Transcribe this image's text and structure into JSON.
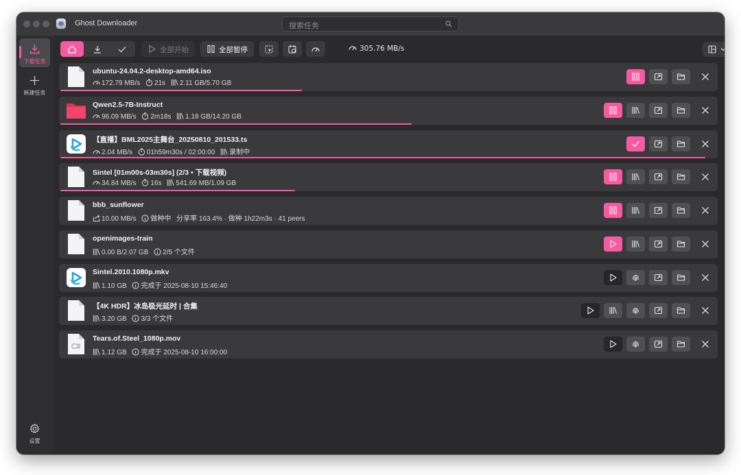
{
  "app": {
    "title": "Ghost Downloader"
  },
  "search": {
    "placeholder": "搜索任务"
  },
  "sidebar": {
    "items": [
      {
        "label": "下载任务",
        "icon": "download-icon",
        "active": true
      },
      {
        "label": "新建任务",
        "icon": "plus-icon",
        "active": false
      }
    ],
    "settings_label": "设置"
  },
  "toolbar": {
    "filters": [
      {
        "icon": "home-icon",
        "active": true
      },
      {
        "icon": "download-icon",
        "active": false
      },
      {
        "icon": "check-icon",
        "active": false
      }
    ],
    "start_all_label": "全部开始",
    "pause_all_label": "全部暂停",
    "total_speed": "305.76 MB/s"
  },
  "colors": {
    "accent": "#f75aa0",
    "background": "#2a2a2c",
    "card": "#3a3a3d"
  },
  "tasks": [
    {
      "name": "ubuntu-24.04.2-desktop-amd64.iso",
      "icon": "file-icon",
      "speed": "172.79 MB/s",
      "eta": "21s",
      "size": "2.11 GB/5.70 GB",
      "progress": 0.368
    },
    {
      "name": "Qwen2.5-7B-Instruct",
      "icon": "folder-icon",
      "speed": "96.09 MB/s",
      "eta": "2m18s",
      "size": "1.18 GB/14.20 GB",
      "progress": 0.536
    },
    {
      "name": "【直播】BML2025主舞台_20250810_201533.ts",
      "icon": "bilibili-icon",
      "speed": "2.04 MB/s",
      "eta": "01h59m30s / 02:00:00",
      "status": "录制中",
      "progress": 0.983
    },
    {
      "name": "Sintel [01m00s-03m30s] (2/3 • 下载视频)",
      "icon": "file-icon",
      "speed": "34.84 MB/s",
      "eta": "16s",
      "size": "541.69 MB/1.09 GB",
      "progress": 0.358
    },
    {
      "name": "bbb_sunflower",
      "icon": "file-icon",
      "speed": "10.00 MB/s",
      "status": "做种中",
      "detail": "分享率 163.4% · 做种 1h22m3s · 41 peers"
    },
    {
      "name": "openimages-train",
      "icon": "file-icon",
      "size": "0.00 B/2.07 GB",
      "detail": "2/5 个文件"
    },
    {
      "name": "Sintel.2010.1080p.mkv",
      "icon": "bilibili-icon",
      "size": "1.10 GB",
      "detail": "完成于 2025-08-10 15:46:40"
    },
    {
      "name": "【4K HDR】冰岛极光延时 | 合集",
      "icon": "file-icon",
      "size": "3.20 GB",
      "detail": "3/3 个文件"
    },
    {
      "name": "Tears.of.Steel_1080p.mov",
      "icon": "video-file-icon",
      "size": "1.12 GB",
      "detail": "完成于 2025-08-10 16:00:00"
    }
  ]
}
